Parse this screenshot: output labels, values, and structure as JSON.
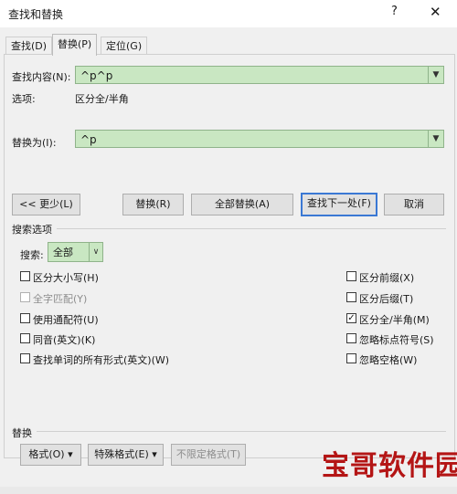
{
  "window": {
    "title": "查找和替换",
    "help": "?",
    "close": "✕"
  },
  "tabs": [
    {
      "label": "查找(D)"
    },
    {
      "label": "替换(P)"
    },
    {
      "label": "定位(G)"
    }
  ],
  "find": {
    "label": "查找内容(N):",
    "value": "^p^p"
  },
  "options": {
    "label": "选项:",
    "value": "区分全/半角"
  },
  "replace": {
    "label": "替换为(I):",
    "value": "^p"
  },
  "buttons": {
    "less": "<< 更少(L)",
    "replace": "替换(R)",
    "replace_all": "全部替换(A)",
    "find_next": "查找下一处(F)",
    "cancel": "取消"
  },
  "search_options": {
    "header": "搜索选项",
    "search_label": "搜索:",
    "search_value": "全部",
    "left": [
      {
        "label": "区分大小写(H)",
        "checked": false,
        "enabled": true
      },
      {
        "label": "全字匹配(Y)",
        "checked": false,
        "enabled": false
      },
      {
        "label": "使用通配符(U)",
        "checked": false,
        "enabled": true
      },
      {
        "label": "同音(英文)(K)",
        "checked": false,
        "enabled": true
      },
      {
        "label": "查找单词的所有形式(英文)(W)",
        "checked": false,
        "enabled": true
      }
    ],
    "right": [
      {
        "label": "区分前缀(X)",
        "checked": false,
        "enabled": true
      },
      {
        "label": "区分后缀(T)",
        "checked": false,
        "enabled": true
      },
      {
        "label": "区分全/半角(M)",
        "checked": true,
        "enabled": true
      },
      {
        "label": "忽略标点符号(S)",
        "checked": false,
        "enabled": true
      },
      {
        "label": "忽略空格(W)",
        "checked": false,
        "enabled": true
      }
    ]
  },
  "replace_section": {
    "header": "替换",
    "format": "格式(O) ▾",
    "special": "特殊格式(E) ▾",
    "no_format": "不限定格式(T)"
  },
  "watermark": "宝哥软件园"
}
